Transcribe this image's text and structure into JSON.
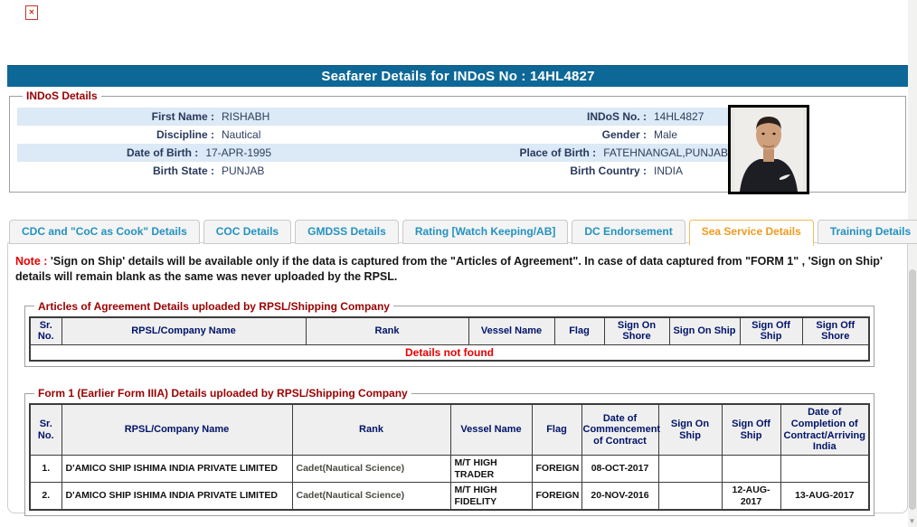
{
  "title": "Seafarer Details for INDoS No : 14HL4827",
  "colors": {
    "title_bar": "#0e6897",
    "row_stripe": "#dce9f6",
    "tab_text": "#2492c0",
    "active_tab_text": "#f09b1c",
    "legend_maroon": "#990000",
    "note_red": "#e60000",
    "table_header_text": "#001368"
  },
  "indos": {
    "legend": "INDoS Details",
    "rows": [
      {
        "label1": "First Name :",
        "value1": "RISHABH",
        "label2": "INDoS No. :",
        "value2": "14HL4827"
      },
      {
        "label1": "Discipline :",
        "value1": "Nautical",
        "label2": "Gender :",
        "value2": "Male"
      },
      {
        "label1": "Date of Birth :",
        "value1": "17-APR-1995",
        "label2": "Place of Birth :",
        "value2": "FATEHNANGAL,PUNJAB"
      },
      {
        "label1": "Birth State :",
        "value1": "PUNJAB",
        "label2": "Birth Country :",
        "value2": "INDIA"
      }
    ]
  },
  "tabs": {
    "items": [
      {
        "label": "CDC and \"CoC as Cook\" Details",
        "active": false
      },
      {
        "label": "COC Details",
        "active": false
      },
      {
        "label": "GMDSS Details",
        "active": false
      },
      {
        "label": "Rating [Watch Keeping/AB]",
        "active": false
      },
      {
        "label": "DC Endorsement",
        "active": false
      },
      {
        "label": "Sea Service Details",
        "active": true
      },
      {
        "label": "Training Details",
        "active": false
      }
    ]
  },
  "note": {
    "prefix": "Note :",
    "text": "'Sign on Ship' details will be available only if the data is captured from the \"Articles of Agreement\". In case of data captured from \"FORM 1\" , 'Sign on Ship' details will remain blank as the same was never uploaded by the RPSL."
  },
  "articles": {
    "legend": "Articles of Agreement Details uploaded by RPSL/Shipping Company",
    "headers": [
      "Sr. No.",
      "RPSL/Company Name",
      "Rank",
      "Vessel Name",
      "Flag",
      "Sign On Shore",
      "Sign On Ship",
      "Sign Off Ship",
      "Sign Off Shore"
    ],
    "empty_message": "Details not found"
  },
  "form1": {
    "legend": "Form 1 (Earlier Form IIIA) Details uploaded by RPSL/Shipping Company",
    "headers": [
      "Sr. No.",
      "RPSL/Company Name",
      "Rank",
      "Vessel Name",
      "Flag",
      "Date of Commencement of Contract",
      "Sign On Ship",
      "Sign Off Ship",
      "Date of Completion of Contract/Arriving India"
    ],
    "rows": [
      [
        "1.",
        "D'AMICO SHIP ISHIMA INDIA PRIVATE LIMITED",
        "Cadet(Nautical Science)",
        "M/T HIGH TRADER",
        "FOREIGN",
        "08-OCT-2017",
        "",
        "",
        ""
      ],
      [
        "2.",
        "D'AMICO SHIP ISHIMA INDIA PRIVATE LIMITED",
        "Cadet(Nautical Science)",
        "M/T HIGH FIDELITY",
        "FOREIGN",
        "20-NOV-2016",
        "",
        "12-AUG-2017",
        "13-AUG-2017"
      ]
    ]
  }
}
